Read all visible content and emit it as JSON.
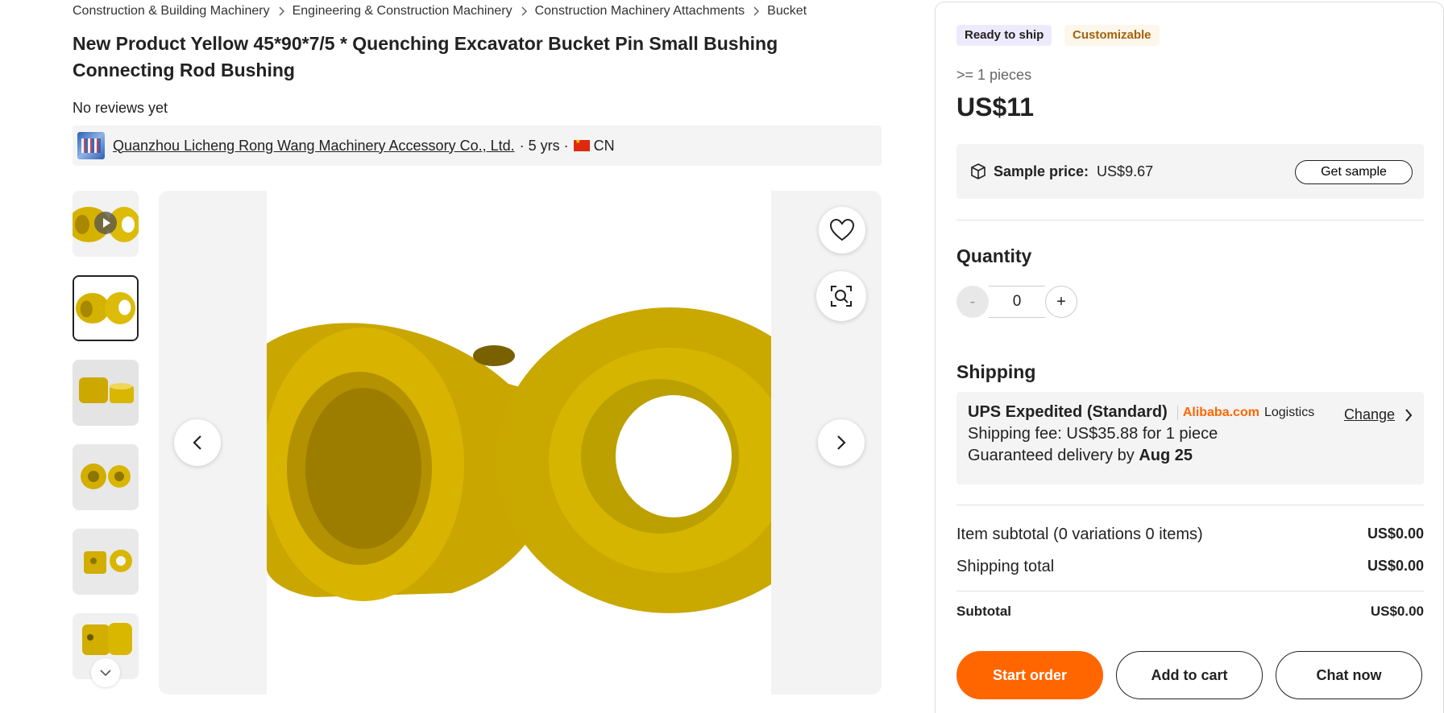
{
  "breadcrumb": [
    "Construction & Building Machinery",
    "Engineering & Construction Machinery",
    "Construction Machinery Attachments",
    "Bucket"
  ],
  "product": {
    "title": "New Product Yellow 45*90*7/5 * Quenching Excavator Bucket Pin Small Bushing Connecting Rod Bushing",
    "reviews": "No reviews yet"
  },
  "supplier": {
    "name": "Quanzhou Licheng Rong Wang Machinery Accessory Co., Ltd.",
    "years": "· 5 yrs ·",
    "country": "CN"
  },
  "gallery": {
    "thumbnail_count": 6,
    "active_thumbnail": 2,
    "icons": [
      "play-icon",
      "chevron-down-icon",
      "chevron-left-icon",
      "chevron-right-icon",
      "heart-icon",
      "image-search-icon"
    ]
  },
  "purchase": {
    "badges": {
      "ready": "Ready to ship",
      "custom": "Customizable"
    },
    "moq": ">= 1 pieces",
    "price": "US$11",
    "sample": {
      "label": "Sample price:",
      "value": "US$9.67",
      "button": "Get sample"
    },
    "quantity": {
      "heading": "Quantity",
      "value": "0",
      "minus": "-",
      "plus": "+"
    },
    "shipping": {
      "heading": "Shipping",
      "service": "UPS Expedited (Standard)",
      "brand": "Alibaba.com",
      "logistics": "Logistics",
      "change": "Change",
      "fee": "Shipping fee: US$35.88 for 1 piece",
      "delivery_prefix": "Guaranteed delivery by",
      "delivery_date": "Aug 25"
    },
    "summary": {
      "item_subtotal_label": "Item subtotal (0 variations 0 items)",
      "item_subtotal_value": "US$0.00",
      "shipping_total_label": "Shipping total",
      "shipping_total_value": "US$0.00",
      "subtotal_label": "Subtotal",
      "subtotal_value": "US$0.00"
    },
    "buttons": {
      "start": "Start order",
      "cart": "Add to cart",
      "chat": "Chat now"
    }
  },
  "colors": {
    "accent": "#ff6600",
    "product_yellow": "#d9b400",
    "badge_ready_bg": "#eeeafd",
    "badge_custom_text": "#a4620c"
  }
}
